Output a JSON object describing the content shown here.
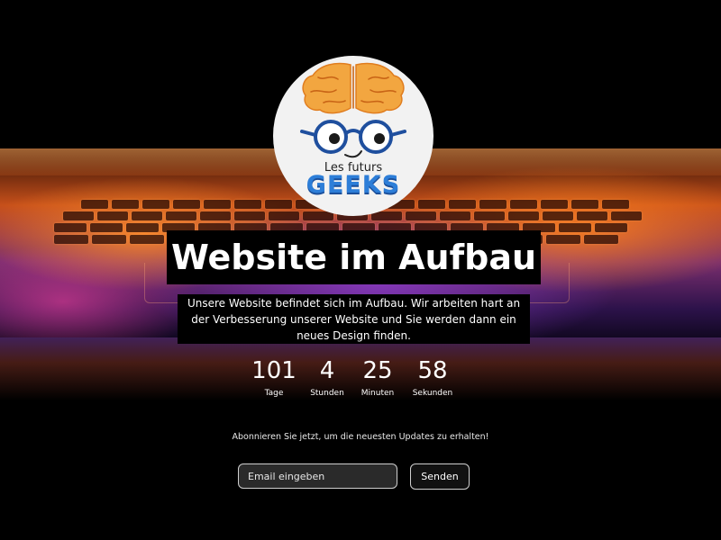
{
  "logo": {
    "small_text": "Les futurs",
    "big_text": "GEEKS"
  },
  "hero": {
    "title": "Website im Aufbau",
    "description": "Unsere Website befindet sich im Aufbau. Wir arbeiten hart an der Verbesserung unserer Website und Sie werden dann ein neues Design finden."
  },
  "countdown": {
    "days": "101",
    "days_label": "Tage",
    "hours": "4",
    "hours_label": "Stunden",
    "minutes": "25",
    "minutes_label": "Minuten",
    "seconds": "58",
    "seconds_label": "Sekunden"
  },
  "subscribe": {
    "text": "Abonnieren Sie jetzt, um die neuesten Updates zu erhalten!",
    "email_placeholder": "Email eingeben",
    "send_label": "Senden"
  },
  "colors": {
    "background": "#000000",
    "logo_blue": "#2d7ed8",
    "logo_brain": "#f2a640"
  }
}
